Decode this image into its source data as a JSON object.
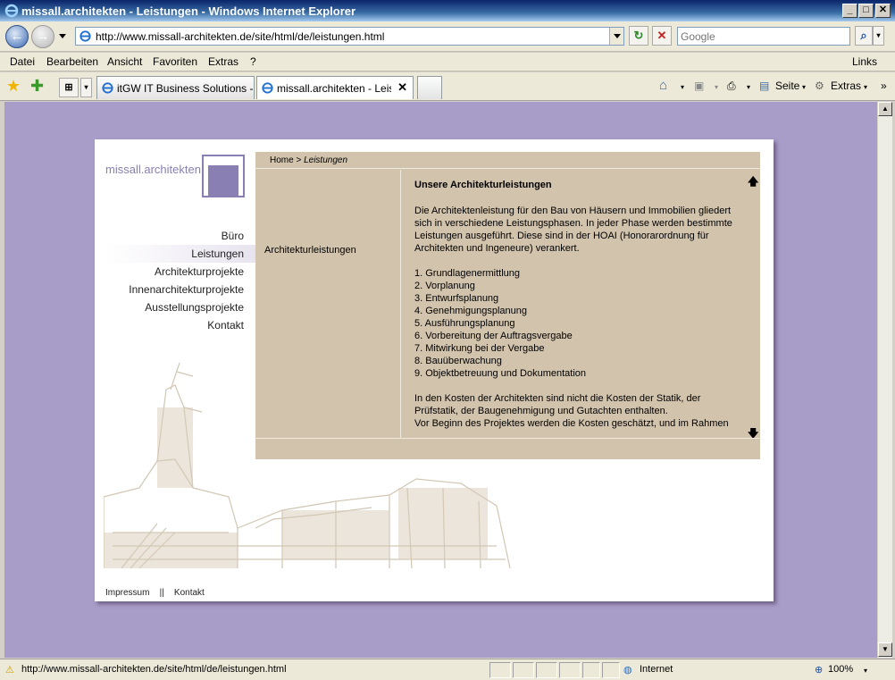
{
  "window": {
    "title": "missall.architekten - Leistungen - Windows Internet Explorer"
  },
  "address": {
    "url": "http://www.missall-architekten.de/site/html/de/leistungen.html"
  },
  "search": {
    "placeholder": "Google"
  },
  "menu": {
    "items": [
      "Datei",
      "Bearbeiten",
      "Ansicht",
      "Favoriten",
      "Extras",
      "?"
    ],
    "links_label": "Links"
  },
  "tabs": [
    {
      "label": "itGW IT Business Solutions - ..."
    },
    {
      "label": "missall.architekten - Leist..."
    }
  ],
  "commands": {
    "page": "Seite",
    "extras": "Extras"
  },
  "site": {
    "logo": "missall.architekten",
    "nav": [
      "Büro",
      "Leistungen",
      "Architekturprojekte",
      "Innenarchitekturprojekte",
      "Ausstellungsprojekte",
      "Kontakt"
    ],
    "breadcrumb_home": "Home >",
    "breadcrumb_current": "Leistungen",
    "subnav": "Architekturleistungen",
    "heading": "Unsere Architekturleistungen",
    "intro": "Die Architektenleistung für den Bau von Häusern und Immobilien gliedert sich in verschiedene Leistungsphasen. In jeder Phase werden bestimmte Leistungen ausgeführt. Diese sind in der HOAI (Honorarordnung für Architekten und Ingeneure) verankert.",
    "phases": [
      "1. Grundlagenermittlung",
      "2. Vorplanung",
      "3. Entwurfsplanung",
      "4. Genehmigungsplanung",
      "5. Ausführungsplanung",
      "6. Vorbereitung der Auftragsvergabe",
      "7. Mitwirkung bei der Vergabe",
      "8. Bauüberwachung",
      "9. Objektbetreuung und Dokumentation"
    ],
    "costs": "In den Kosten der Architekten sind nicht die Kosten der Statik, der Prüfstatik, der Baugenehmigung und Gutachten enthalten.",
    "costs2": "Vor Beginn des Projektes werden die Kosten geschätzt, und im Rahmen",
    "footer_impressum": "Impressum",
    "footer_sep": "||",
    "footer_kontakt": "Kontakt"
  },
  "status": {
    "url": "http://www.missall-architekten.de/site/html/de/leistungen.html",
    "zone": "Internet",
    "zoom": "100%"
  },
  "colors": {
    "page_bg": "#a89cc8",
    "content_bg": "#d2c3ad",
    "brand": "#8a7fb3"
  }
}
